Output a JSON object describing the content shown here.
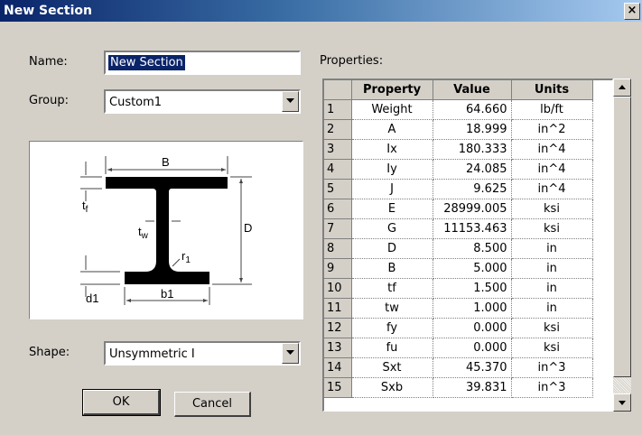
{
  "window": {
    "title": "New Section",
    "close_glyph": "×"
  },
  "form": {
    "name_label": "Name:",
    "name_value": "New Section",
    "group_label": "Group:",
    "group_value": "Custom1",
    "shape_label": "Shape:",
    "shape_value": "Unsymmetric I",
    "ok_label": "OK",
    "cancel_label": "Cancel"
  },
  "diagram": {
    "labels": {
      "B": "B",
      "tf": "t",
      "tf_sub": "f",
      "tw": "t",
      "tw_sub": "w",
      "r1": "r",
      "r1_sub": "1",
      "D": "D",
      "d1": "d1",
      "b1": "b1"
    }
  },
  "properties": {
    "title": "Properties:",
    "headers": [
      "Property",
      "Value",
      "Units"
    ],
    "rows": [
      {
        "n": "1",
        "property": "Weight",
        "value": "64.660",
        "units": "lb/ft"
      },
      {
        "n": "2",
        "property": "A",
        "value": "18.999",
        "units": "in^2"
      },
      {
        "n": "3",
        "property": "Ix",
        "value": "180.333",
        "units": "in^4"
      },
      {
        "n": "4",
        "property": "Iy",
        "value": "24.085",
        "units": "in^4"
      },
      {
        "n": "5",
        "property": "J",
        "value": "9.625",
        "units": "in^4"
      },
      {
        "n": "6",
        "property": "E",
        "value": "28999.005",
        "units": "ksi"
      },
      {
        "n": "7",
        "property": "G",
        "value": "11153.463",
        "units": "ksi"
      },
      {
        "n": "8",
        "property": "D",
        "value": "8.500",
        "units": "in"
      },
      {
        "n": "9",
        "property": "B",
        "value": "5.000",
        "units": "in"
      },
      {
        "n": "10",
        "property": "tf",
        "value": "1.500",
        "units": "in"
      },
      {
        "n": "11",
        "property": "tw",
        "value": "1.000",
        "units": "in"
      },
      {
        "n": "12",
        "property": "fy",
        "value": "0.000",
        "units": "ksi"
      },
      {
        "n": "13",
        "property": "fu",
        "value": "0.000",
        "units": "ksi"
      },
      {
        "n": "14",
        "property": "Sxt",
        "value": "45.370",
        "units": "in^3"
      },
      {
        "n": "15",
        "property": "Sxb",
        "value": "39.831",
        "units": "in^3"
      }
    ]
  },
  "icons": {
    "dropdown": "chevron-down-icon",
    "scroll_up": "arrow-up-icon",
    "scroll_down": "arrow-down-icon",
    "close": "close-icon"
  }
}
